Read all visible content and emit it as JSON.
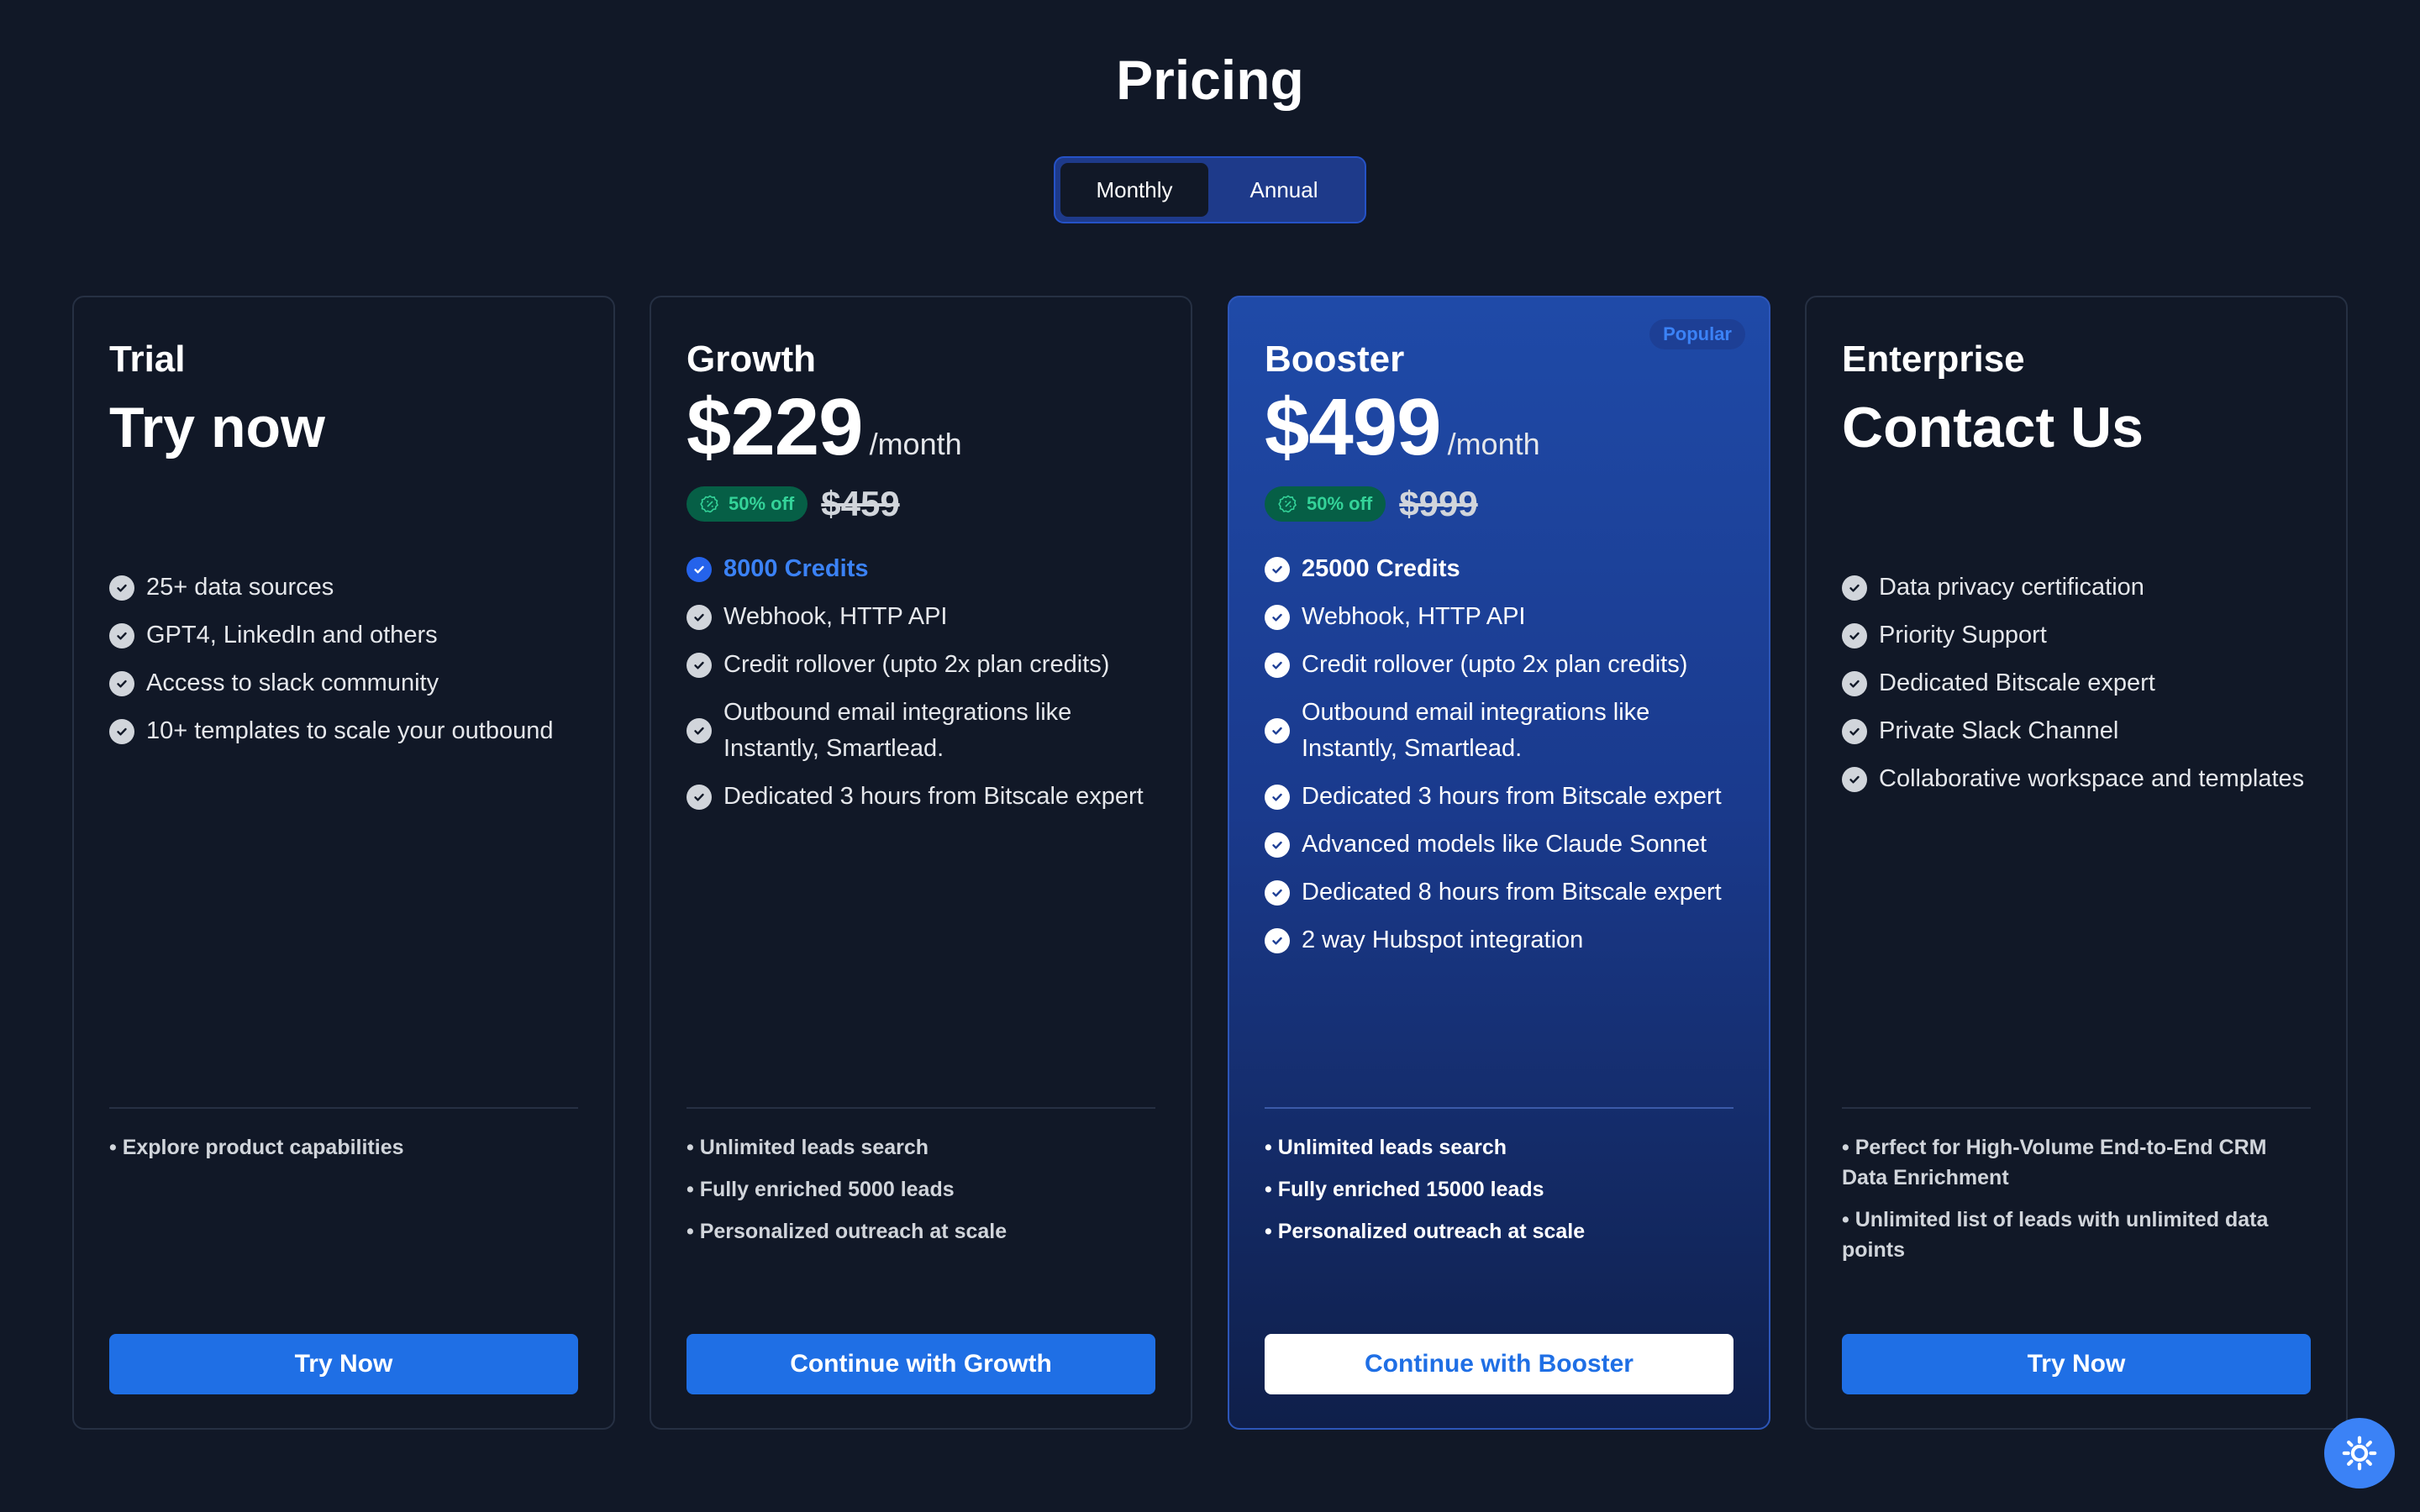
{
  "title": "Pricing",
  "toggle": {
    "monthly": "Monthly",
    "annual": "Annual"
  },
  "plans": [
    {
      "name": "Trial",
      "headline": "Try now",
      "features": [
        "25+ data sources",
        "GPT4, LinkedIn and others",
        "Access to slack community",
        "10+ templates to scale your outbound"
      ],
      "extras": [
        "• Explore product capabilities"
      ],
      "cta": "Try Now"
    },
    {
      "name": "Growth",
      "price": "$229",
      "per": "/month",
      "discount": "50% off",
      "old_price": "$459",
      "credits": "8000 Credits",
      "features": [
        "Webhook, HTTP API",
        "Credit rollover (upto 2x plan credits)",
        "Outbound email integrations like Instantly, Smartlead.",
        "Dedicated 3 hours from Bitscale expert"
      ],
      "extras": [
        "• Unlimited leads search",
        "• Fully enriched 5000 leads",
        "• Personalized outreach at scale"
      ],
      "cta": "Continue with Growth"
    },
    {
      "name": "Booster",
      "badge": "Popular",
      "price": "$499",
      "per": "/month",
      "discount": "50% off",
      "old_price": "$999",
      "credits": "25000 Credits",
      "features": [
        "Webhook, HTTP API",
        "Credit rollover (upto 2x plan credits)",
        "Outbound email integrations like Instantly, Smartlead.",
        "Dedicated 3 hours from Bitscale expert",
        "Advanced models like Claude Sonnet",
        "Dedicated 8 hours from Bitscale expert",
        "2 way Hubspot integration"
      ],
      "extras": [
        "• Unlimited leads search",
        "• Fully enriched 15000 leads",
        "• Personalized outreach at scale"
      ],
      "cta": "Continue with Booster"
    },
    {
      "name": "Enterprise",
      "headline": "Contact Us",
      "features": [
        "Data privacy certification",
        "Priority Support",
        "Dedicated Bitscale expert",
        "Private Slack Channel",
        "Collaborative workspace and templates"
      ],
      "extras": [
        "• Perfect for High-Volume End-to-End CRM Data Enrichment",
        "• Unlimited list of leads with unlimited data points"
      ],
      "cta": "Try Now"
    }
  ],
  "colors": {
    "background": "#111827",
    "accent": "#1f6fe5",
    "featured": "#1f4aa8",
    "discount_bg": "#065f46",
    "discount_text": "#34d399"
  },
  "icons": {
    "check": "check-circle-icon",
    "discount": "badge-percent-icon",
    "fab": "sun-icon"
  }
}
